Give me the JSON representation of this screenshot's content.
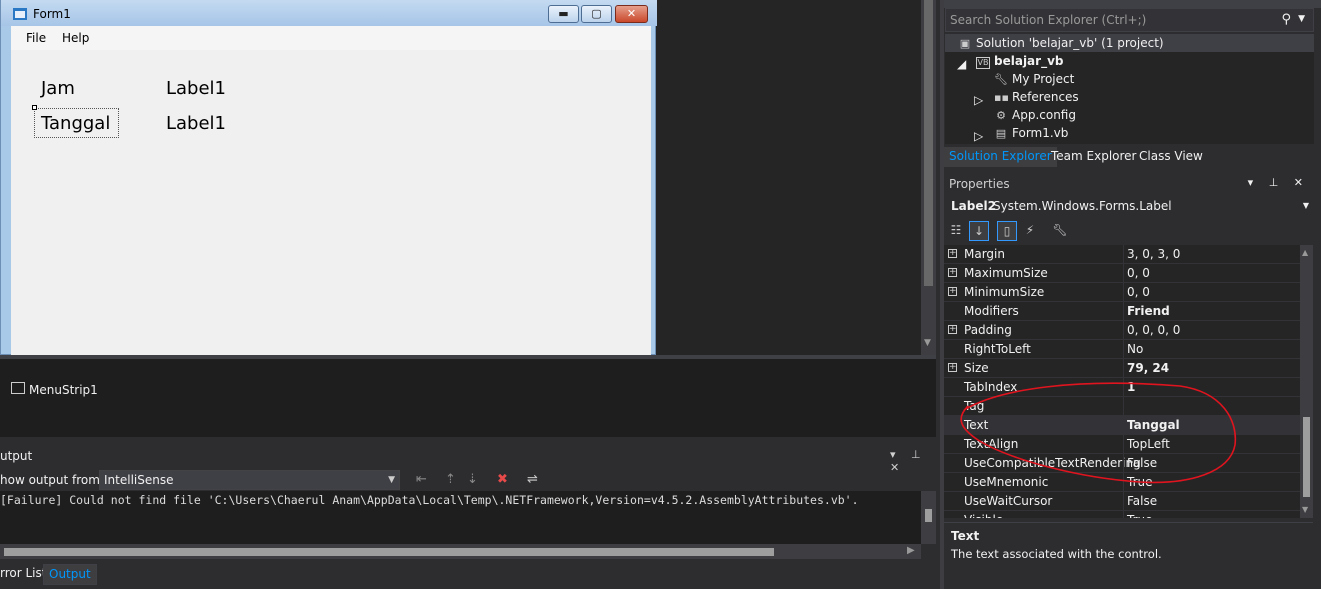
{
  "form": {
    "title": "Form1",
    "controls": {
      "minimize": "▬",
      "maximize": "▢",
      "close": "✕"
    },
    "menu": [
      "File",
      "Help"
    ],
    "labels": [
      {
        "name": "jam",
        "text": "Jam"
      },
      {
        "name": "jam-value",
        "text": "Label1"
      },
      {
        "name": "tanggal",
        "text": "Tanggal"
      },
      {
        "name": "tanggal-value",
        "text": "Label1"
      }
    ]
  },
  "tray": {
    "component": "MenuStrip1"
  },
  "output": {
    "title": "utput",
    "show_from_label": "how output from:",
    "source": "IntelliSense",
    "message": "[Failure] Could not find file 'C:\\Users\\Chaerul Anam\\AppData\\Local\\Temp\\.NETFramework,Version=v4.5.2.AssemblyAttributes.vb'.",
    "controls": "▾ ⊥ ✕"
  },
  "bottom_tabs": {
    "errors": "rror List",
    "output": "Output"
  },
  "solution_explorer": {
    "search_placeholder": "Search Solution Explorer (Ctrl+;)",
    "tree": {
      "solution": "Solution 'belajar_vb' (1 project)",
      "project": "belajar_vb",
      "my_project": "My Project",
      "references": "References",
      "app_config": "App.config",
      "form1": "Form1.vb"
    },
    "tabs": {
      "solution_explorer": "Solution Explorer",
      "team_explorer": "Team Explorer",
      "class_view": "Class View"
    }
  },
  "properties": {
    "title": "Properties",
    "controls": "▾ ⊥ ✕",
    "object_name": "Label2",
    "object_type": "System.Windows.Forms.Label",
    "rows": [
      {
        "name": "Margin",
        "value": "3, 0, 3, 0",
        "expand": true,
        "bold": false
      },
      {
        "name": "MaximumSize",
        "value": "0, 0",
        "expand": true,
        "bold": false
      },
      {
        "name": "MinimumSize",
        "value": "0, 0",
        "expand": true,
        "bold": false
      },
      {
        "name": "Modifiers",
        "value": "Friend",
        "expand": false,
        "bold": true
      },
      {
        "name": "Padding",
        "value": "0, 0, 0, 0",
        "expand": true,
        "bold": false
      },
      {
        "name": "RightToLeft",
        "value": "No",
        "expand": false,
        "bold": false
      },
      {
        "name": "Size",
        "value": "79, 24",
        "expand": true,
        "bold": true
      },
      {
        "name": "TabIndex",
        "value": "1",
        "expand": false,
        "bold": true
      },
      {
        "name": "Tag",
        "value": "",
        "expand": false,
        "bold": false
      },
      {
        "name": "Text",
        "value": "Tanggal",
        "expand": false,
        "bold": true
      },
      {
        "name": "TextAlign",
        "value": "TopLeft",
        "expand": false,
        "bold": false
      },
      {
        "name": "UseCompatibleTextRendering",
        "value": "False",
        "expand": false,
        "bold": false
      },
      {
        "name": "UseMnemonic",
        "value": "True",
        "expand": false,
        "bold": false
      },
      {
        "name": "UseWaitCursor",
        "value": "False",
        "expand": false,
        "bold": false
      },
      {
        "name": "Visible",
        "value": "True",
        "expand": false,
        "bold": false
      }
    ],
    "selected_row": "Text",
    "description_title": "Text",
    "description_text": "The text associated with the control."
  },
  "colors": {
    "accent": "#0097fb",
    "annotation": "#e0141e",
    "form_border": "#a9c9e8"
  }
}
